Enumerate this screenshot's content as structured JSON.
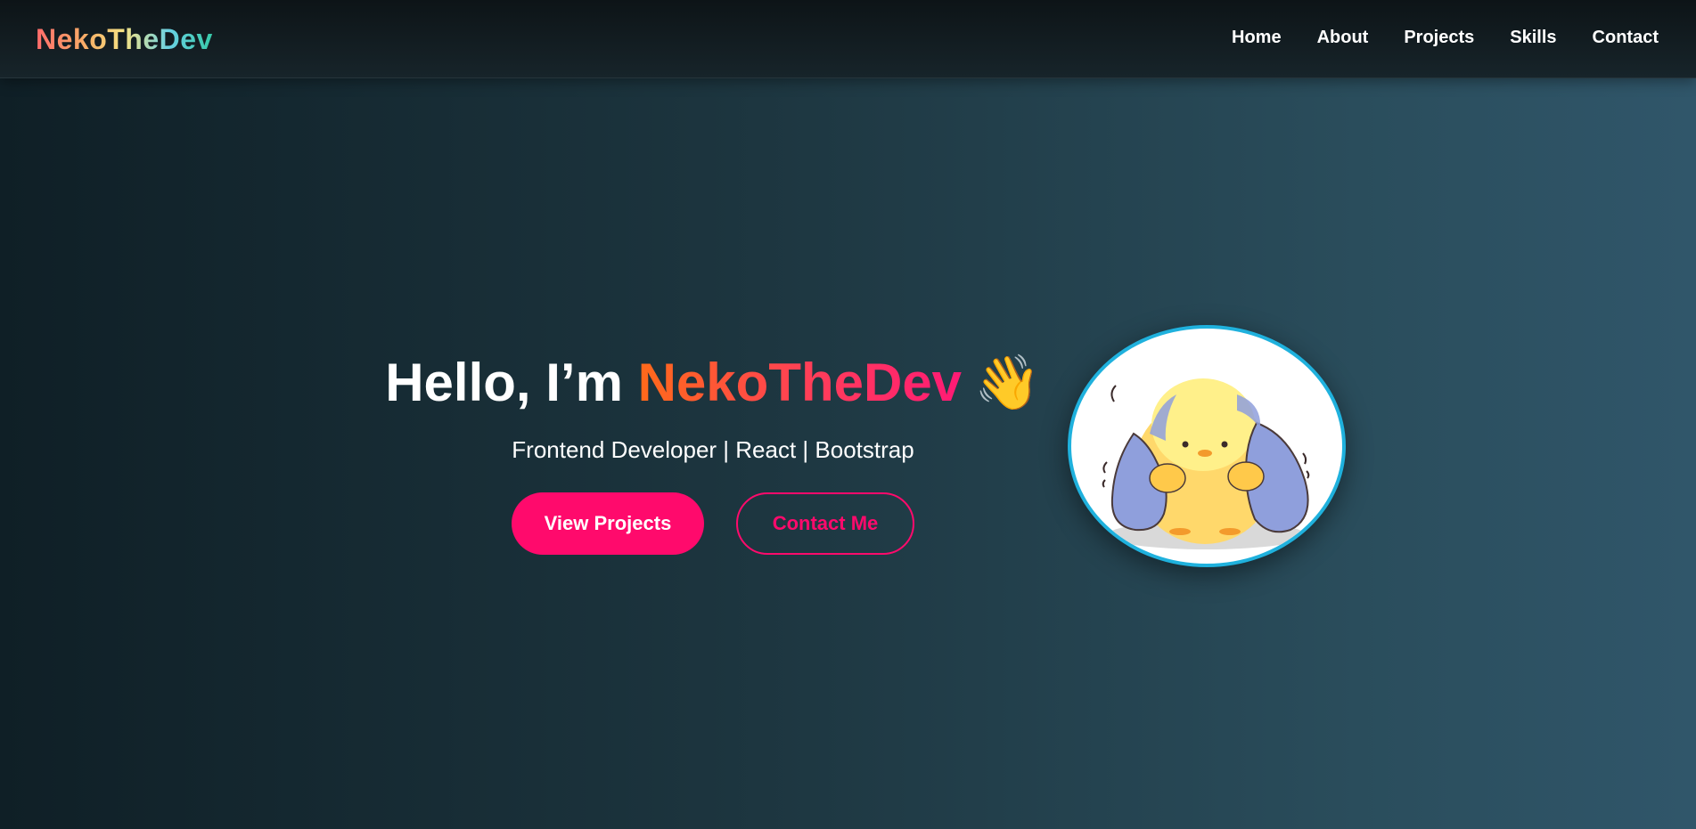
{
  "navbar": {
    "brand": "NekoTheDev",
    "links": [
      "Home",
      "About",
      "Projects",
      "Skills",
      "Contact"
    ]
  },
  "hero": {
    "greeting": "Hello, I’m ",
    "name": "NekoTheDev",
    "wave_emoji": "👋",
    "subtitle": "Frontend Developer | React | Bootstrap",
    "primary_button": "View Projects",
    "secondary_button": "Contact Me"
  },
  "avatar": {
    "icon": "chick-in-blanket-illustration"
  },
  "colors": {
    "accent_pink": "#ff0a6c",
    "avatar_border": "#1fb1dd",
    "nav_background": "#111b1f"
  }
}
